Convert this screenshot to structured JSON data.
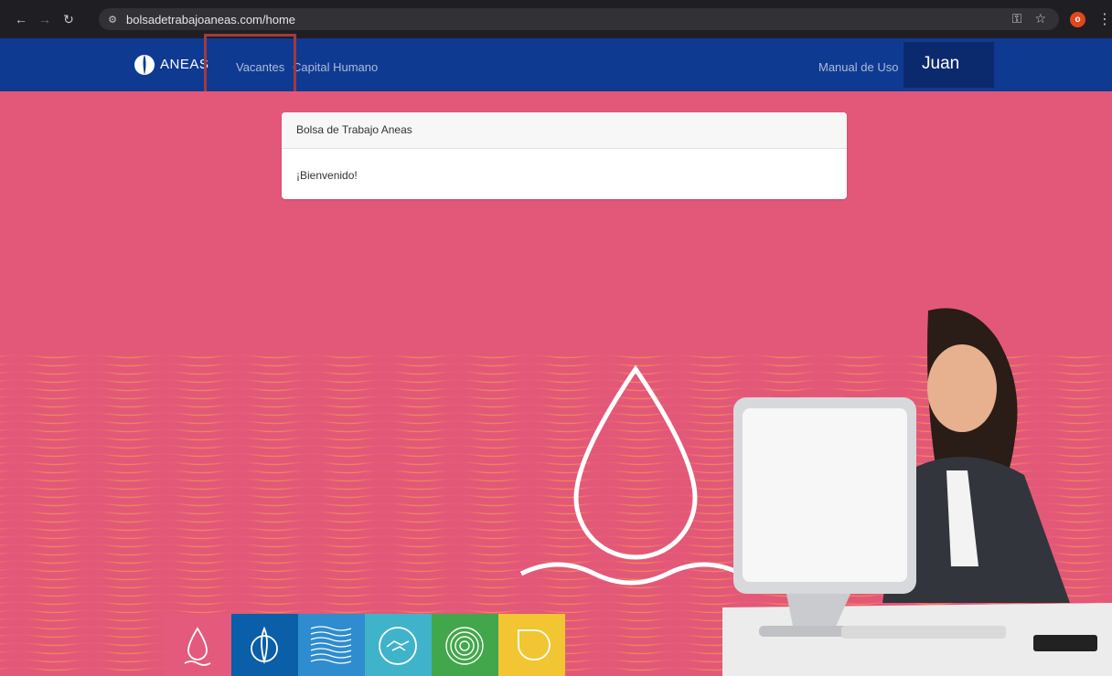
{
  "browser": {
    "url": "bolsadetrabajoaneas.com/home",
    "profile_initial": "o"
  },
  "navbar": {
    "brand": "ANEAS",
    "links": [
      "Vacantes",
      "Capital Humano"
    ],
    "manual": "Manual de Uso",
    "user": "Juan",
    "bg_color": "#0f3a92"
  },
  "card": {
    "header": "Bolsa de Trabajo Aneas",
    "body": "¡Bienvenido!"
  },
  "background_color": "#e35878",
  "tiles": [
    {
      "icon": "water-drop-icon",
      "color": "#e35a7c"
    },
    {
      "icon": "aneas-logo-icon",
      "color": "#0b5ea8"
    },
    {
      "icon": "waves-icon",
      "color": "#2e8ccf"
    },
    {
      "icon": "handshake-icon",
      "color": "#3fb3c9"
    },
    {
      "icon": "concentric-circles-icon",
      "color": "#42a74a"
    },
    {
      "icon": "leaf-shape-icon",
      "color": "#f2c532"
    }
  ]
}
